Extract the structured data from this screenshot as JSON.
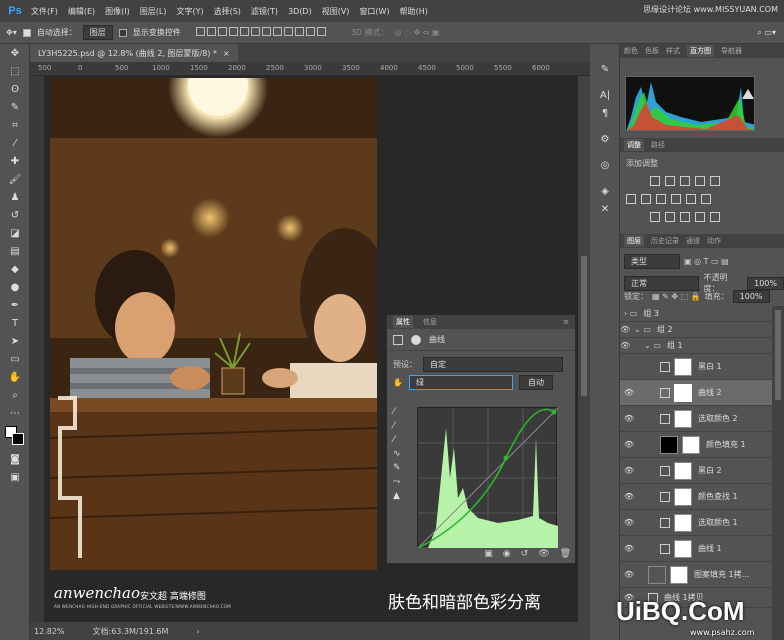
{
  "app": {
    "logo": "Ps",
    "watermark": "思缘设计论坛 www.MISSYUAN.COM"
  },
  "menu": [
    "文件(F)",
    "编辑(E)",
    "图像(I)",
    "图层(L)",
    "文字(Y)",
    "选择(S)",
    "滤镜(T)",
    "3D(D)",
    "视图(V)",
    "窗口(W)",
    "帮助(H)"
  ],
  "options": {
    "auto_select": "自动选择：",
    "layer_dropdown": "图层",
    "show_transform": "显示变换控件",
    "mode_3d": "3D 模式："
  },
  "doc": {
    "tab": "LY3H5225.psd @ 12.8% (曲线 2, 图层蒙版/8) *",
    "close": "×"
  },
  "ruler": [
    "500",
    "0",
    "500",
    "1000",
    "1500",
    "2000",
    "2500",
    "3000",
    "3500",
    "4000",
    "4500",
    "5000",
    "5500",
    "6000"
  ],
  "status": {
    "zoom": "12.82%",
    "doc": "文档:63.3M/191.6M",
    "arrow": "›"
  },
  "canvas": {
    "caption": "肤色和暗部色彩分离",
    "logo": "anwenchao",
    "logo_cn": "安文超 高端修图",
    "logo_small": "AN WENCHAO HIGH-END GRAPHIC OFFICIAL WEBSITE/WWW.ANWENCHAO.COM"
  },
  "props": {
    "tab1": "属性",
    "tab2": "信息",
    "title": "曲线",
    "preset_label": "预设：",
    "preset_value": "自定",
    "channel": "绿",
    "auto": "自动"
  },
  "right": {
    "tabs1": [
      "颜色",
      "色板",
      "样式",
      "直方图",
      "导航器"
    ],
    "tabs2": [
      "调整",
      "路径"
    ],
    "adjust_label": "添加调整",
    "tabs3": [
      "图层",
      "历史记录",
      "通道",
      "动作"
    ],
    "filter_type": "类型",
    "blend": "正常",
    "opacity_label": "不透明度：",
    "opacity": "100%",
    "lock_label": "锁定：",
    "fill_label": "填充：",
    "fill": "100%",
    "groups": {
      "g3": "组 3",
      "g2": "组 2",
      "g1": "组 1"
    },
    "layers": [
      "黑白 1",
      "曲线 2",
      "选取颜色 2",
      "颜色填充 1",
      "黑白 2",
      "颜色查找 1",
      "选取颜色 1",
      "曲线 1",
      "图案填充 1拷...",
      "曲线 1拷贝"
    ]
  },
  "brand": {
    "uibq": "UiBQ.CoM",
    "url": "www.psahz.com"
  },
  "colors": {
    "accent": "#31a8ff",
    "curve": "#2db82d",
    "histogram_fill": "#b6f2a8"
  }
}
